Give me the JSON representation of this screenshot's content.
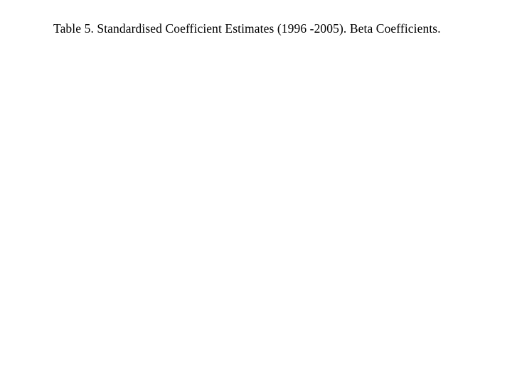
{
  "caption": {
    "text": "Table 5. Standardised Coefficient Estimates (1996 -2005). Beta Coefficients."
  }
}
